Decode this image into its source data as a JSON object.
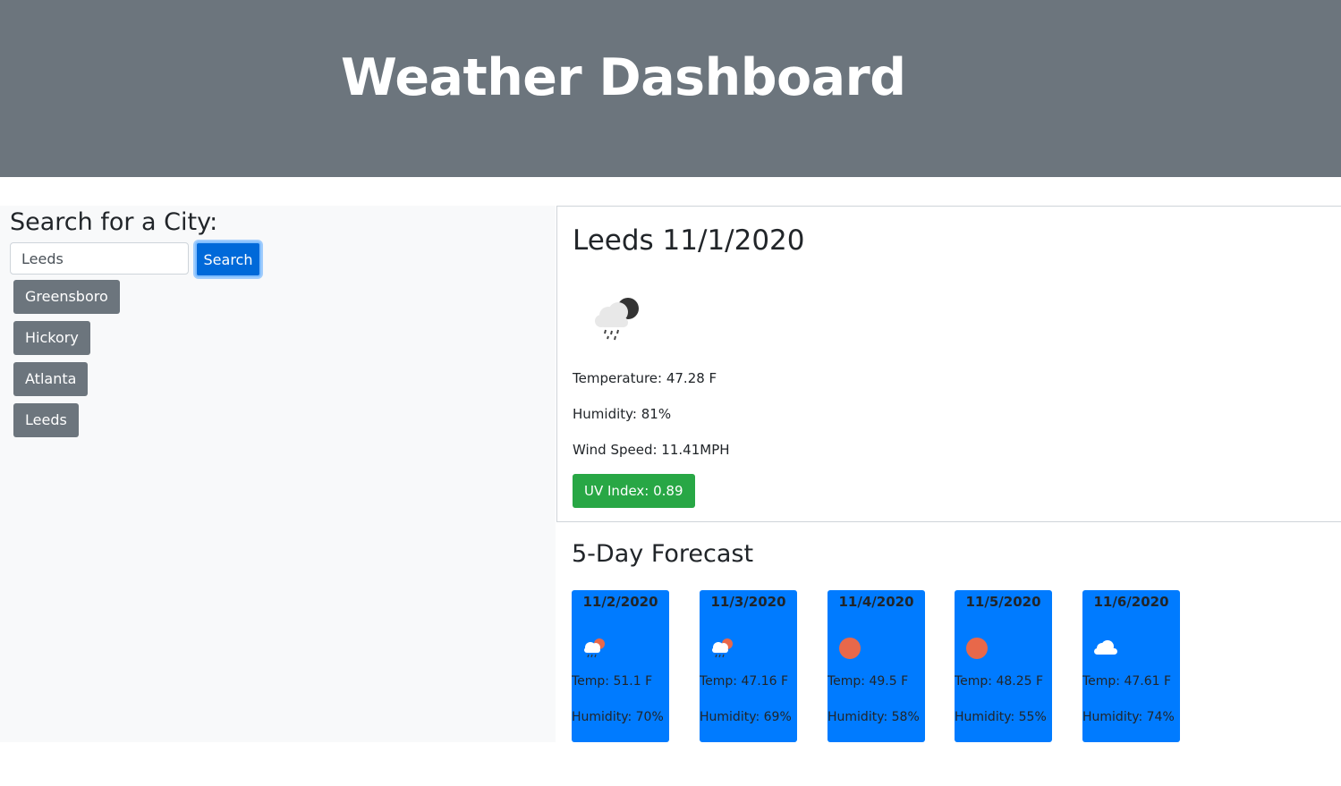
{
  "header": {
    "title": "Weather Dashboard"
  },
  "sidebar": {
    "search_title": "Search for a City:",
    "search_value": "Leeds",
    "search_button": "Search",
    "cities": [
      "Greensboro",
      "Hickory",
      "Atlanta",
      "Leeds"
    ]
  },
  "current": {
    "city_date": "Leeds 11/1/2020",
    "icon": "cloud-rain-moon-icon",
    "temperature": "Temperature: 47.28 F",
    "humidity": "Humidity: 81%",
    "wind": "Wind Speed: 11.41MPH",
    "uv": "UV Index: 0.89"
  },
  "forecast": {
    "title": "5-Day Forecast",
    "days": [
      {
        "date": "11/2/2020",
        "icon": "cloud-rain-sun-icon",
        "temp": "Temp: 51.1 F",
        "humidity": "Humidity: 70%"
      },
      {
        "date": "11/3/2020",
        "icon": "cloud-rain-sun-icon",
        "temp": "Temp: 47.16 F",
        "humidity": "Humidity: 69%"
      },
      {
        "date": "11/4/2020",
        "icon": "sun-icon",
        "temp": "Temp: 49.5 F",
        "humidity": "Humidity: 58%"
      },
      {
        "date": "11/5/2020",
        "icon": "sun-icon",
        "temp": "Temp: 48.25 F",
        "humidity": "Humidity: 55%"
      },
      {
        "date": "11/6/2020",
        "icon": "cloud-icon",
        "temp": "Temp: 47.61 F",
        "humidity": "Humidity: 74%"
      }
    ]
  },
  "colors": {
    "header_bg": "#6c757d",
    "primary": "#007bff",
    "success": "#28a745",
    "secondary": "#6c757d",
    "sun": "#e8684a"
  }
}
